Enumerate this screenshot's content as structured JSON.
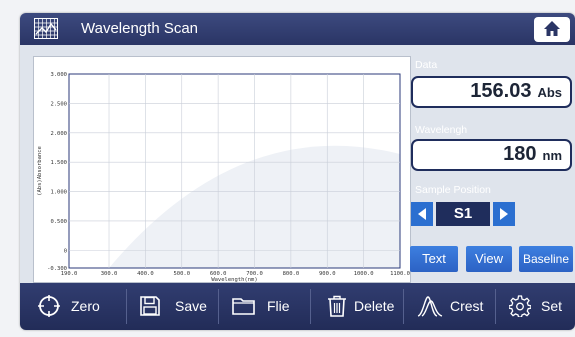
{
  "window": {
    "title": "Wavelength Scan",
    "title_icon": "grid-chart-icon",
    "home_icon": "home-icon"
  },
  "chart": {
    "y_axis_label": "(Abs)Absorbance",
    "x_axis_label": "Wavelength(nm)",
    "y_ticks": [
      "3.000",
      "2.500",
      "2.000",
      "1.500",
      "1.000",
      "0.500",
      "0",
      "-0.300"
    ],
    "x_ticks": [
      "190.0",
      "300.0",
      "400.0",
      "500.0",
      "600.0",
      "700.0",
      "800.0",
      "900.0",
      "1000.0",
      "1100.0"
    ]
  },
  "chart_data": {
    "type": "line",
    "title": "",
    "xlabel": "Wavelength(nm)",
    "ylabel": "(Abs)Absorbance",
    "xlim": [
      190,
      1100
    ],
    "ylim": [
      -0.3,
      3.0
    ],
    "grid": true,
    "series": []
  },
  "panel": {
    "data_label": "Data",
    "data_value": "156.03",
    "data_unit": "Abs",
    "wavelength_label": "Wavelengh",
    "wavelength_value": "180",
    "wavelength_unit": "nm",
    "sample_position_label": "Sample Position",
    "sample_position_value": "S1",
    "buttons": {
      "text": "Text",
      "view": "View",
      "baseline": "Baseline"
    }
  },
  "toolbar": {
    "zero": "Zero",
    "save": "Save",
    "file": "Flie",
    "delete": "Delete",
    "crest": "Crest",
    "set": "Set"
  },
  "colors": {
    "titlebar": "#2f3a6e",
    "accent_blue": "#2c6cd4",
    "box_border": "#1f2d5c"
  }
}
